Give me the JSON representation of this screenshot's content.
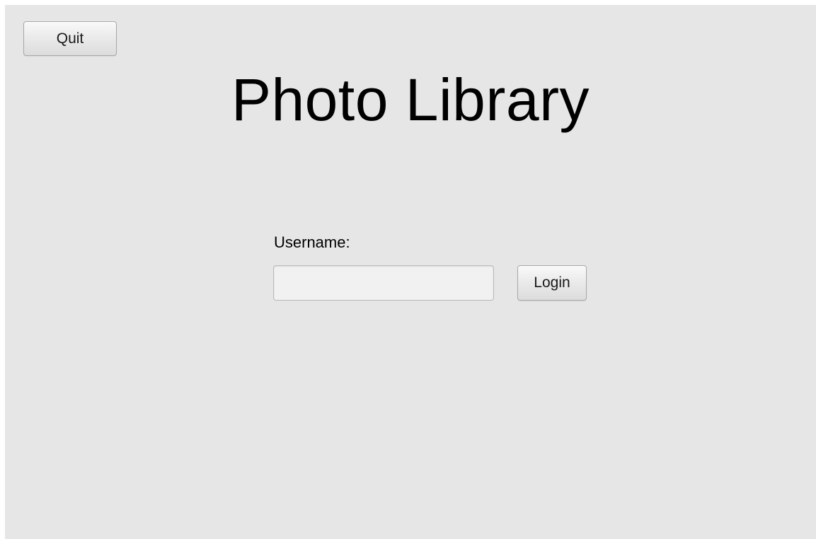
{
  "window": {
    "background": "#e6e6e6"
  },
  "toolbar": {
    "quit_label": "Quit"
  },
  "header": {
    "title": "Photo Library"
  },
  "login_form": {
    "username_label": "Username:",
    "username_value": "",
    "username_placeholder": "",
    "login_label": "Login"
  }
}
